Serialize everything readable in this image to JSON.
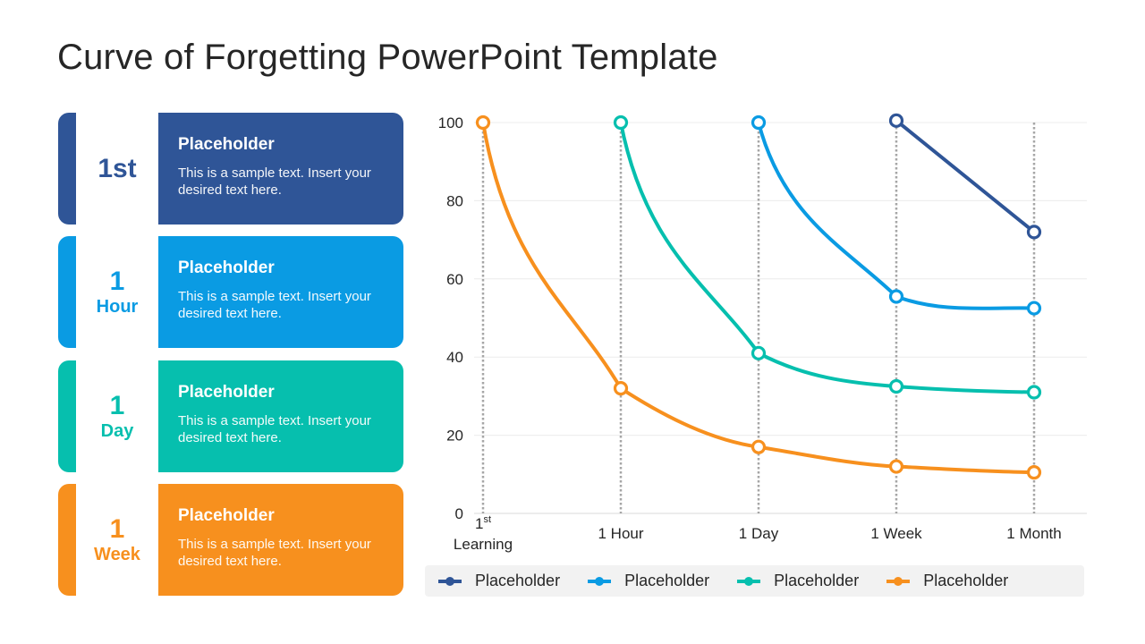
{
  "title": "Curve of Forgetting PowerPoint Template",
  "colors": {
    "dark_blue": "#2f5597",
    "light_blue": "#0a9be3",
    "teal": "#06bfae",
    "orange": "#f7901e"
  },
  "cards": [
    {
      "big": "1st",
      "small": "",
      "heading": "Placeholder",
      "text": "This is a sample text. Insert your desired text here.",
      "color": "#2f5597"
    },
    {
      "big": "1",
      "small": "Hour",
      "heading": "Placeholder",
      "text": "This is a sample text. Insert your desired text here.",
      "color": "#0a9be3"
    },
    {
      "big": "1",
      "small": "Day",
      "heading": "Placeholder",
      "text": "This is a sample text. Insert your desired text here.",
      "color": "#06bfae"
    },
    {
      "big": "1",
      "small": "Week",
      "heading": "Placeholder",
      "text": "This is a sample text. Insert your desired text here.",
      "color": "#f7901e"
    }
  ],
  "chart_data": {
    "type": "line",
    "title": "",
    "xlabel": "",
    "ylabel": "",
    "categories": [
      "1st Learning",
      "1 Hour",
      "1 Day",
      "1 Week",
      "1 Month"
    ],
    "category_labels": [
      {
        "main": "1",
        "sup": "st",
        "line2": "Learning"
      },
      {
        "main": "1 Hour"
      },
      {
        "main": "1 Day"
      },
      {
        "main": "1 Week"
      },
      {
        "main": "1 Month"
      }
    ],
    "ylim": [
      0,
      100
    ],
    "yticks": [
      0,
      20,
      40,
      60,
      80,
      100
    ],
    "grid": true,
    "legend_position": "bottom",
    "series": [
      {
        "name": "Placeholder",
        "color": "#2f5597",
        "smooth": false,
        "values": [
          null,
          null,
          null,
          100.5,
          72
        ]
      },
      {
        "name": "Placeholder",
        "color": "#0a9be3",
        "smooth": true,
        "values": [
          null,
          null,
          100,
          55.5,
          52.5
        ]
      },
      {
        "name": "Placeholder",
        "color": "#06bfae",
        "smooth": true,
        "values": [
          null,
          100,
          41,
          32.5,
          31
        ]
      },
      {
        "name": "Placeholder",
        "color": "#f7901e",
        "smooth": true,
        "values": [
          100,
          32,
          17,
          12,
          10.5
        ]
      }
    ]
  }
}
